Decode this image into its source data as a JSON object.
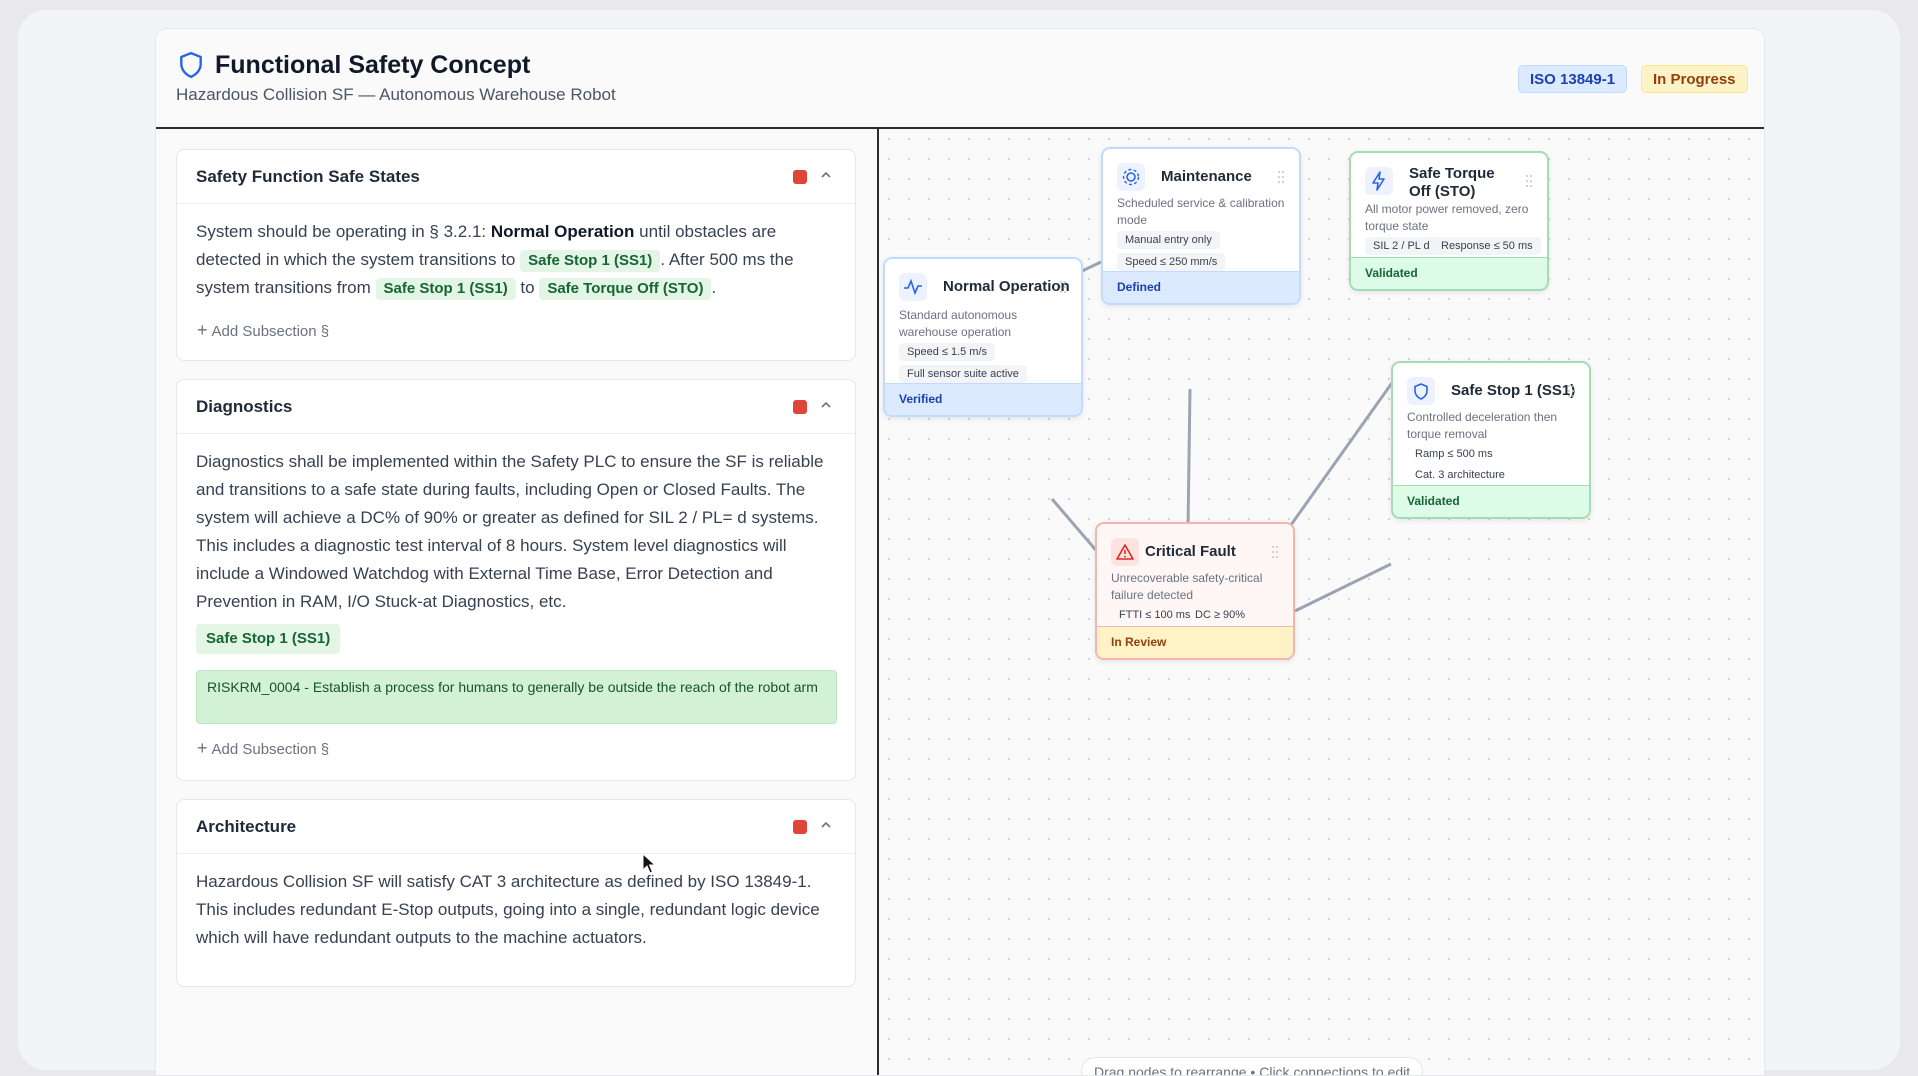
{
  "header": {
    "title": "Functional Safety Concept",
    "subtitle": "Hazardous Collision SF — Autonomous Warehouse Robot",
    "standard_badge": "ISO 13849-1",
    "status_badge": "In Progress"
  },
  "sections": [
    {
      "title": "Safety Function Safe States",
      "body_parts": {
        "p1": "System should be operating in § 3.2.1: ",
        "bold": "Normal Operation",
        "p2": " until obstacles are detected in which the system transitions to ",
        "tag1": "Safe Stop 1 (SS1)",
        "p3": ". After 500 ms the system transitions from ",
        "tag2": "Safe Stop 1 (SS1)",
        "p4": " to ",
        "tag3": "Safe Torque Off (STO)",
        "p5": "."
      },
      "add_label": "Add Subsection §"
    },
    {
      "title": "Diagnostics",
      "body": "Diagnostics shall be implemented within the Safety PLC to ensure the SF is reliable and transitions to a safe state during faults, including Open or Closed Faults. The system will achieve a DC% of 90% or greater as defined for SIL 2 / PL= d systems. This includes a diagnostic test interval of 8 hours. System level diagnostics will include a Windowed Watchdog with External Time Base, Error Detection and Prevention in RAM, I/O Stuck-at Diagnostics, etc.",
      "tag": "Safe Stop 1 (SS1)",
      "risk": "RISKRM_0004 - Establish a process for humans to generally be outside the reach of the robot arm",
      "add_label": "Add Subsection §"
    },
    {
      "title": "Architecture",
      "body": "Hazardous Collision SF will satisfy CAT 3 architecture as defined by ISO 13849-1. This includes redundant E-Stop outputs, going into a single, redundant logic device which will have redundant outputs to the machine actuators."
    }
  ],
  "nodes": {
    "normal": {
      "title": "Normal Operation",
      "desc": "Standard autonomous warehouse operation",
      "chips": [
        "Speed ≤ 1.5 m/s",
        "Full sensor suite active"
      ],
      "status": "Verified",
      "icon": "activity-icon"
    },
    "maintenance": {
      "title": "Maintenance",
      "desc": "Scheduled service & calibration mode",
      "chips": [
        "Manual entry only",
        "Speed ≤ 250 mm/s"
      ],
      "status": "Defined",
      "icon": "gear-icon"
    },
    "sto": {
      "title": "Safe Torque Off (STO)",
      "desc": "All motor power removed, zero torque state",
      "chips": [
        "SIL 2 / PL d",
        "Response ≤ 50 ms"
      ],
      "status": "Validated",
      "icon": "lightning-icon"
    },
    "ss1": {
      "title": "Safe Stop 1 (SS1)",
      "desc": "Controlled deceleration then torque removal",
      "chips": [
        "Ramp ≤ 500 ms",
        "Cat. 3 architecture"
      ],
      "status": "Validated",
      "icon": "shield-icon"
    },
    "fault": {
      "title": "Critical Fault",
      "desc": "Unrecoverable safety-critical failure detected",
      "chips": [
        "FTTI ≤ 100 ms",
        "DC ≥ 90%"
      ],
      "status": "In Review",
      "icon": "warning-icon"
    }
  },
  "canvas_hint": "Drag nodes to rearrange • Click connections to edit",
  "colors": {
    "accent": "#2563eb",
    "danger": "#e0453a",
    "success": "#166534",
    "warning": "#92400e"
  }
}
